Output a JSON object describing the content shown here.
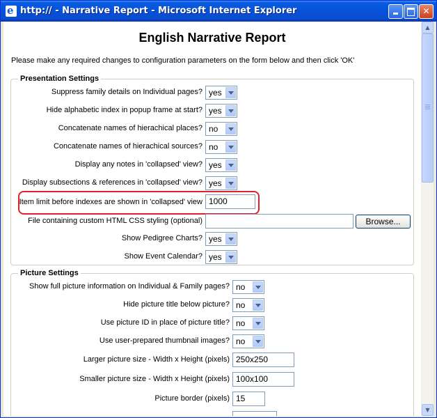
{
  "window": {
    "title": "http:// - Narrative Report - Microsoft Internet Explorer",
    "ie_icon_glyph": "e",
    "min_glyph": "",
    "max_glyph": "",
    "close_glyph": "✕"
  },
  "page": {
    "heading": "English Narrative Report",
    "instructions": "Please make any required changes to configuration parameters on the form below and then click 'OK'"
  },
  "presentation": {
    "legend": "Presentation Settings",
    "rows": [
      {
        "label": "Suppress family details on Individual pages?",
        "value": "yes"
      },
      {
        "label": "Hide alphabetic index in popup frame at start?",
        "value": "yes"
      },
      {
        "label": "Concatenate names of hierachical places?",
        "value": "no"
      },
      {
        "label": "Concatenate names of hierachical sources?",
        "value": "no"
      },
      {
        "label": "Display any notes in 'collapsed' view?",
        "value": "yes"
      },
      {
        "label": "Display subsections & references in 'collapsed' view?",
        "value": "yes"
      }
    ],
    "item_limit": {
      "label": "Item limit before indexes are shown in 'collapsed' view",
      "value": "1000"
    },
    "css_file": {
      "label": "File containing custom HTML CSS styling (optional)",
      "value": "",
      "browse_label": "Browse..."
    },
    "pedigree": {
      "label": "Show Pedigree Charts?",
      "value": "yes"
    },
    "calendar": {
      "label": "Show Event Calendar?",
      "value": "yes"
    }
  },
  "pictures": {
    "legend": "Picture Settings",
    "rows": [
      {
        "label": "Show full picture information on Individual & Family pages?",
        "value": "no"
      },
      {
        "label": "Hide picture title below picture?",
        "value": "no"
      },
      {
        "label": "Use picture ID in place of picture title?",
        "value": "no"
      },
      {
        "label": "Use user-prepared thumbnail images?",
        "value": "no"
      }
    ],
    "larger_size": {
      "label": "Larger picture size  - Width x Height (pixels)",
      "value": "250x250"
    },
    "smaller_size": {
      "label": "Smaller picture size - Width x Height (pixels)",
      "value": "100x100"
    },
    "border": {
      "label": "Picture border (pixels)",
      "value": "15"
    }
  },
  "colors": {
    "highlight": "#E0202A",
    "titlebar": "#0553D8"
  }
}
